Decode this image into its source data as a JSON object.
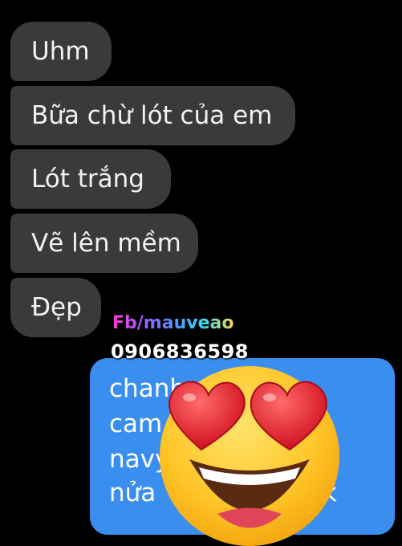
{
  "received_messages": [
    {
      "text": "Uhm"
    },
    {
      "text": "Bữa chừ lót của em"
    },
    {
      "text": "Lót trắng"
    },
    {
      "text": "Vẽ lên mềm"
    },
    {
      "text": "Đẹp"
    }
  ],
  "watermark": {
    "fb_text": "Fb/mauveao",
    "phone": "0906836598"
  },
  "sent_message": {
    "lines": [
      "chanh",
      "cam",
      "navy",
      "nửa",
      "k"
    ]
  },
  "overlay": {
    "icon": "heart-eyes-emoji"
  },
  "colors": {
    "background": "#000000",
    "received_bubble": "#3a3a3c",
    "sent_bubble": "#3a8ef0"
  }
}
